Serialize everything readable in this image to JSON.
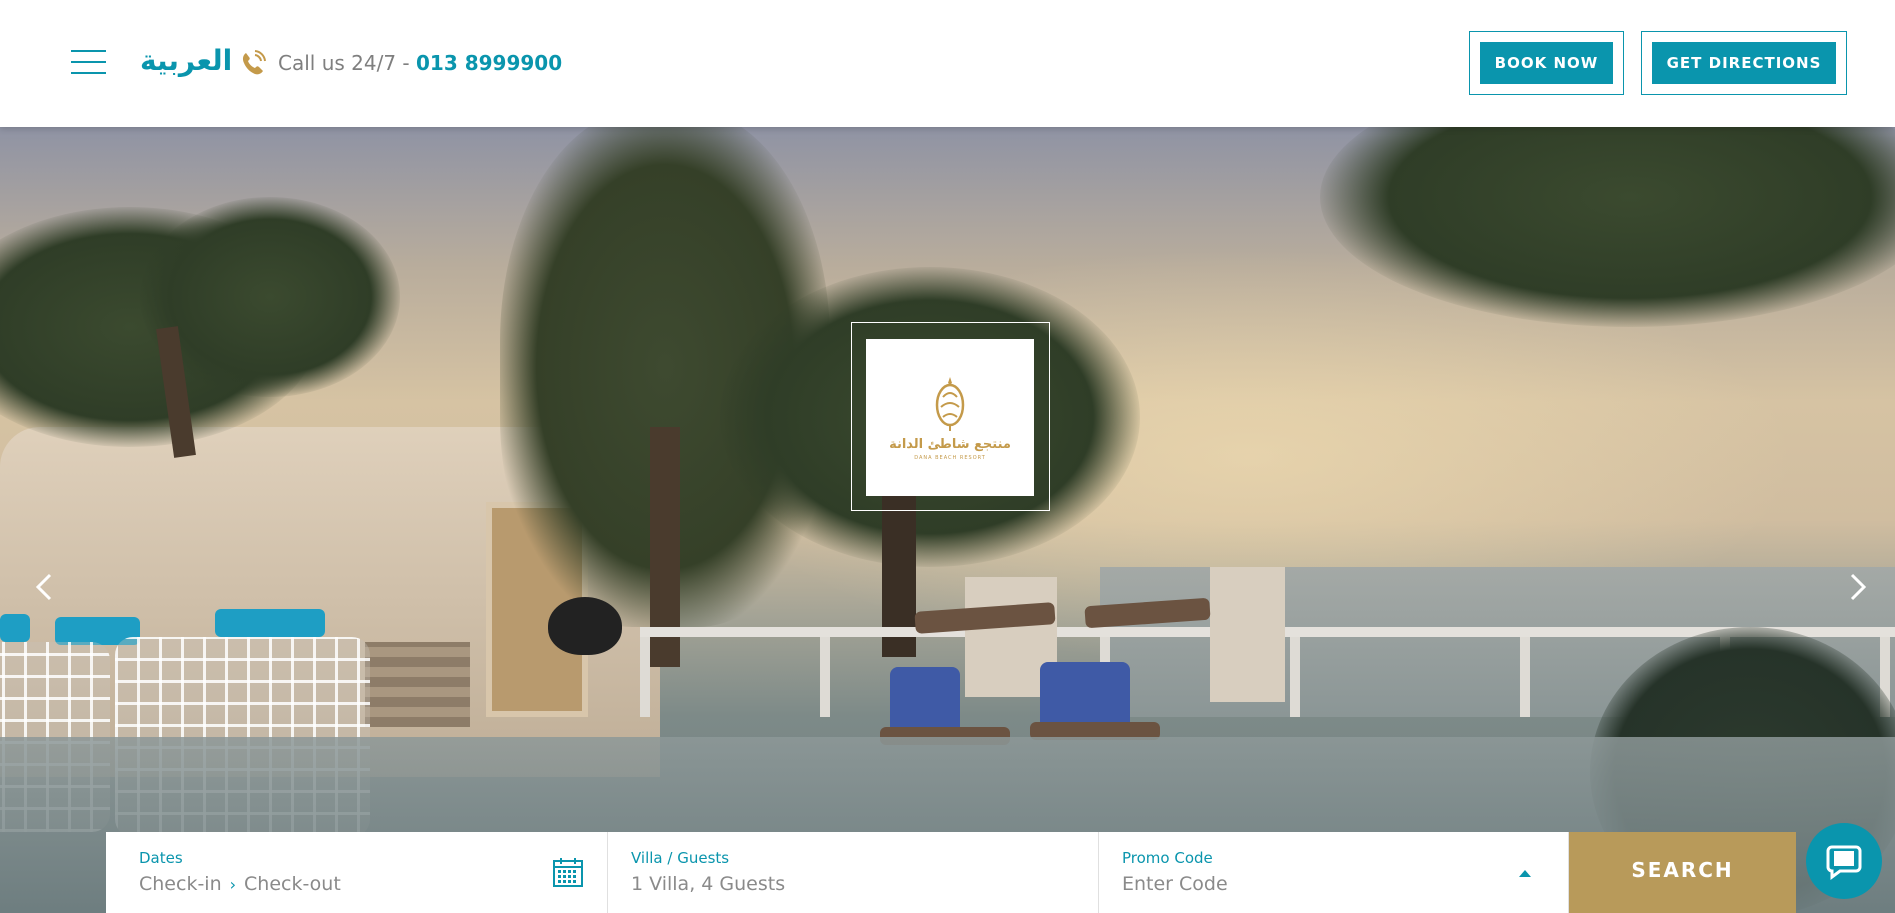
{
  "header": {
    "language_label": "العربية",
    "call_prefix": "Call us 24/7 - ",
    "phone_number": "013 8999900",
    "book_now_label": "BOOK NOW",
    "get_directions_label": "GET DIRECTIONS"
  },
  "hero": {
    "logo": {
      "arabic_name": "منتجع شاطئ الدانة",
      "english_name": "DANA BEACH RESORT"
    },
    "prev_icon": "chevron-left-icon",
    "next_icon": "chevron-right-icon"
  },
  "booking": {
    "dates_label": "Dates",
    "checkin_placeholder": "Check-in",
    "checkout_placeholder": "Check-out",
    "guests_label": "Villa / Guests",
    "guests_value": "1 Villa, 4 Guests",
    "promo_label": "Promo Code",
    "promo_placeholder": "Enter Code",
    "search_label": "SEARCH"
  },
  "colors": {
    "accent": "#0a95ad",
    "gold": "#b89a5a"
  }
}
